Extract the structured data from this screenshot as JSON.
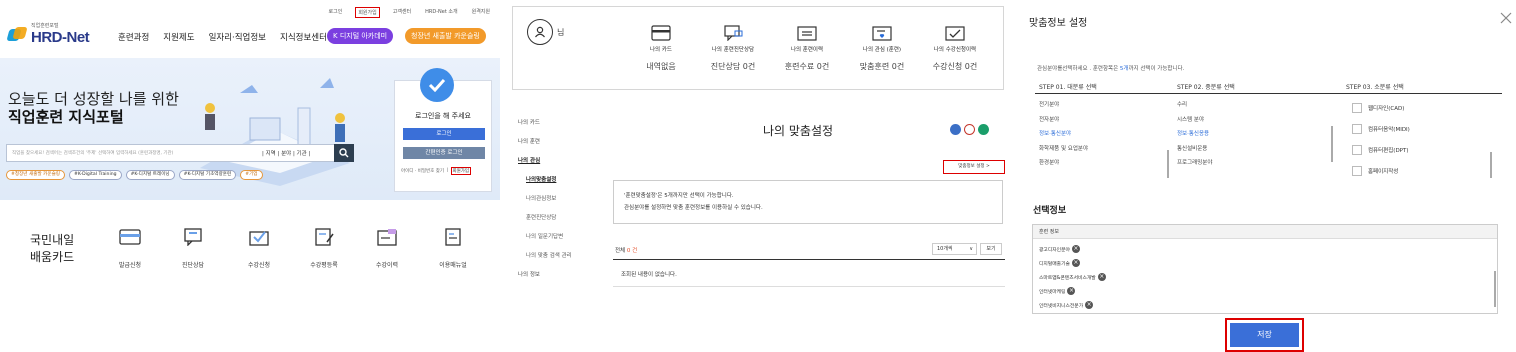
{
  "hrd": {
    "top_links": [
      "로그인",
      "회원가입",
      "고객센터",
      "HRD-Net 소개",
      "원격지원"
    ],
    "logo_sub": "직업훈련포털",
    "logo_name": "HRD-Net",
    "gnb": [
      "훈련과정",
      "지원제도",
      "일자리·직업정보",
      "지식정보센터"
    ],
    "academy_btn": "K 디지털 아카데미",
    "card_btn": "청장년 새출발 카운슬링",
    "hero_line1": "오늘도 더 성장할 나를 위한",
    "hero_line2": "직업훈련 지식포털",
    "search_placeholder": "직업을 찾으세요! 검색어는 검색조건의 '주제' 선택하여 입력하세요 (훈련과정명, 기관)",
    "search_options": "| 지역 | 분야 | 기관 |",
    "tags": [
      "#청장년 새출발 카운슬링",
      "#K-Digital Training",
      "#K-디지털 트레이닝",
      "#K-디지털 기초역량훈련",
      "#기업"
    ],
    "login_title": "로그인을 해 주세요",
    "login_btn": "로그인",
    "cert_login_btn": "간편인증 로그인",
    "login_links": [
      "아이디 · 비밀번호 찾기",
      "|",
      "회원가입"
    ],
    "bottom_title": "국민내일\n배움카드",
    "bottom_items": [
      "발급신청",
      "진단상담",
      "수강신청",
      "수강평등록",
      "수강이력",
      "이용매뉴얼"
    ]
  },
  "mypage": {
    "user_name": "님",
    "cards": [
      {
        "label": "나의 카드",
        "value": "내역없음"
      },
      {
        "label": "나의 훈련진단상담",
        "value": "진단상담 0건"
      },
      {
        "label": "나의 훈련이력",
        "value": "훈련수료 0건"
      },
      {
        "label": "나의 관심 (훈련)",
        "value": "맞춤훈련 0건"
      },
      {
        "label": "나의 수강신청이력",
        "value": "수강신청 0건"
      }
    ],
    "lnb": [
      "나의 카드",
      "나의 훈련",
      "나의 관심",
      "나의맞춤설정",
      "나의관심정보",
      "훈련진단상담",
      "나의 일문기답변",
      "나의 맞춤 검색 관리",
      "나의 정보"
    ],
    "title": "나의 맞춤설정",
    "settings_btn": "맞춤정보 설정 >",
    "notice_line1": "'훈련맞춤설정'은 5개까지만 선택이 가능합니다.",
    "notice_line2": "관심분야를 설정하면 맞춤 훈련정보를 이용하실 수 있습니다.",
    "total_label": "전체",
    "total_count": "0 건",
    "page_size": "10개씩",
    "view_btn": "보기",
    "empty_text": "조회된 내용이 없습니다."
  },
  "modal": {
    "title": "맞춤정보 설정",
    "desc_prefix": "관심분야를선택하세요 . 훈련항목은",
    "desc_highlight": "5개",
    "desc_suffix": "까지 선택이 가능합니다.",
    "step1": "STEP 01. 대분류 선택",
    "step2": "STEP 02. 중분류 선택",
    "step3": "STEP 03. 소분류 선택",
    "col1": [
      "전기분야",
      "전자분야",
      "정보·통신분야",
      "화학제품 및 요업분야",
      "환경분야"
    ],
    "col2": [
      "수리",
      "시스템 분야",
      "정보·통신응용",
      "통신설비운용",
      "프로그래밍분야"
    ],
    "col3": [
      "웹디자인(CAD)",
      "컴퓨터음악(MIDI)",
      "컴퓨터편집(DPT)",
      "홈페이지작성"
    ],
    "selected_title": "선택정보",
    "selected_header": "훈련 정보",
    "selected_items": [
      "광고디자인분야",
      "디지털매출기술",
      "스마트앱&콘텐츠서비스개발",
      "인터넷마케팅",
      "인터넷비지니스전문가"
    ],
    "save_btn": "저장"
  }
}
